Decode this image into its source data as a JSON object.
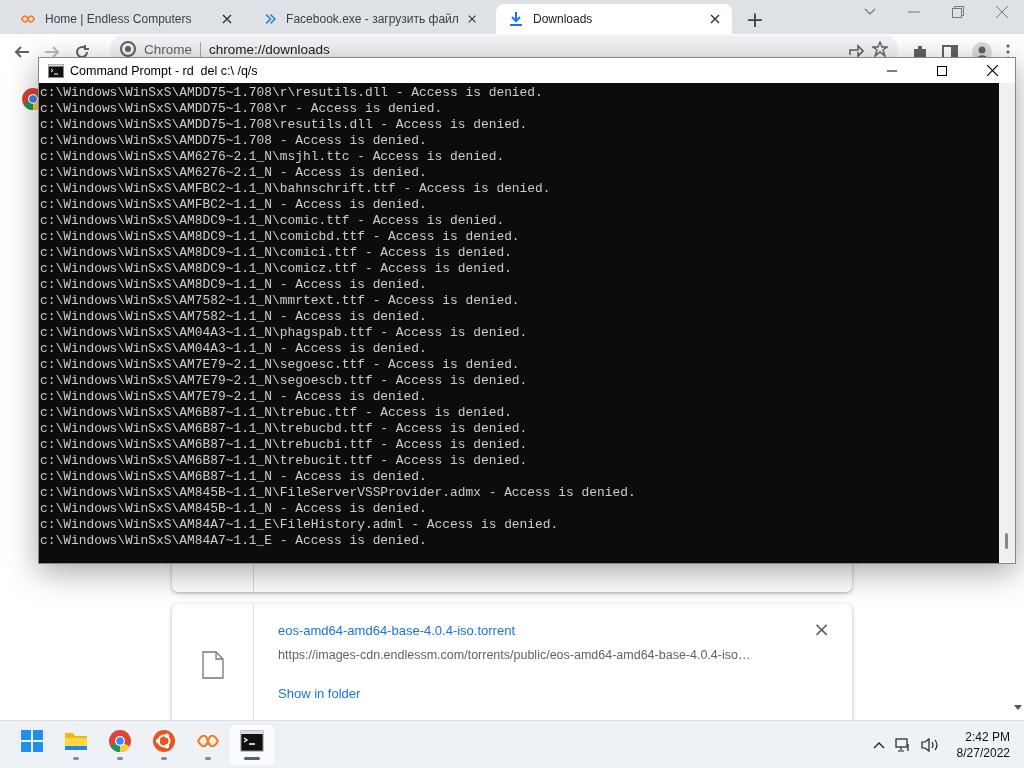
{
  "browser": {
    "tabs": [
      {
        "title": "Home | Endless Computers",
        "kind": "endless",
        "selected": false
      },
      {
        "title": "Facebook.exe - загрузить файл",
        "kind": "chevron",
        "selected": false
      },
      {
        "title": "Downloads",
        "kind": "download",
        "selected": true
      }
    ],
    "new_tab": "+",
    "address": {
      "site": "Chrome",
      "url": "chrome://downloads"
    }
  },
  "console": {
    "title": "Command Prompt - rd  del c:\\ /q/s",
    "lines": [
      "c:\\Windows\\WinSxS\\AMDD75~1.708\\r\\resutils.dll - Access is denied.",
      "c:\\Windows\\WinSxS\\AMDD75~1.708\\r - Access is denied.",
      "c:\\Windows\\WinSxS\\AMDD75~1.708\\resutils.dll - Access is denied.",
      "c:\\Windows\\WinSxS\\AMDD75~1.708 - Access is denied.",
      "c:\\Windows\\WinSxS\\AM6276~2.1_N\\msjhl.ttc - Access is denied.",
      "c:\\Windows\\WinSxS\\AM6276~2.1_N - Access is denied.",
      "c:\\Windows\\WinSxS\\AMFBC2~1.1_N\\bahnschrift.ttf - Access is denied.",
      "c:\\Windows\\WinSxS\\AMFBC2~1.1_N - Access is denied.",
      "c:\\Windows\\WinSxS\\AM8DC9~1.1_N\\comic.ttf - Access is denied.",
      "c:\\Windows\\WinSxS\\AM8DC9~1.1_N\\comicbd.ttf - Access is denied.",
      "c:\\Windows\\WinSxS\\AM8DC9~1.1_N\\comici.ttf - Access is denied.",
      "c:\\Windows\\WinSxS\\AM8DC9~1.1_N\\comicz.ttf - Access is denied.",
      "c:\\Windows\\WinSxS\\AM8DC9~1.1_N - Access is denied.",
      "c:\\Windows\\WinSxS\\AM7582~1.1_N\\mmrtext.ttf - Access is denied.",
      "c:\\Windows\\WinSxS\\AM7582~1.1_N - Access is denied.",
      "c:\\Windows\\WinSxS\\AM04A3~1.1_N\\phagspab.ttf - Access is denied.",
      "c:\\Windows\\WinSxS\\AM04A3~1.1_N - Access is denied.",
      "c:\\Windows\\WinSxS\\AM7E79~2.1_N\\segoesc.ttf - Access is denied.",
      "c:\\Windows\\WinSxS\\AM7E79~2.1_N\\segoescb.ttf - Access is denied.",
      "c:\\Windows\\WinSxS\\AM7E79~2.1_N - Access is denied.",
      "c:\\Windows\\WinSxS\\AM6B87~1.1_N\\trebuc.ttf - Access is denied.",
      "c:\\Windows\\WinSxS\\AM6B87~1.1_N\\trebucbd.ttf - Access is denied.",
      "c:\\Windows\\WinSxS\\AM6B87~1.1_N\\trebucbi.ttf - Access is denied.",
      "c:\\Windows\\WinSxS\\AM6B87~1.1_N\\trebucit.ttf - Access is denied.",
      "c:\\Windows\\WinSxS\\AM6B87~1.1_N - Access is denied.",
      "c:\\Windows\\WinSxS\\AM845B~1.1_N\\FileServerVSSProvider.admx - Access is denied.",
      "c:\\Windows\\WinSxS\\AM845B~1.1_N - Access is denied.",
      "c:\\Windows\\WinSxS\\AM84A7~1.1_E\\FileHistory.adml - Access is denied.",
      "c:\\Windows\\WinSxS\\AM84A7~1.1_E - Access is denied."
    ]
  },
  "downloads": {
    "items": [
      {
        "kind": "hidden"
      },
      {
        "kind": "file",
        "filename": "eos-amd64-amd64-base-4.0.4-iso.torrent",
        "url": "https://images-cdn.endlessm.com/torrents/public/eos-amd64-amd64-base-4.0.4-iso…",
        "action": "Show in folder",
        "close": "×"
      }
    ]
  },
  "taskbar": {
    "apps": [
      {
        "kind": "start",
        "running": false,
        "active": false
      },
      {
        "kind": "folder",
        "running": true,
        "active": false
      },
      {
        "kind": "chrome",
        "running": true,
        "active": false
      },
      {
        "kind": "ubuntu",
        "running": true,
        "active": false
      },
      {
        "kind": "endless",
        "running": true,
        "active": false
      },
      {
        "kind": "console",
        "running": true,
        "active": true
      }
    ],
    "time": "2:42 PM",
    "date": "8/27/2022"
  }
}
